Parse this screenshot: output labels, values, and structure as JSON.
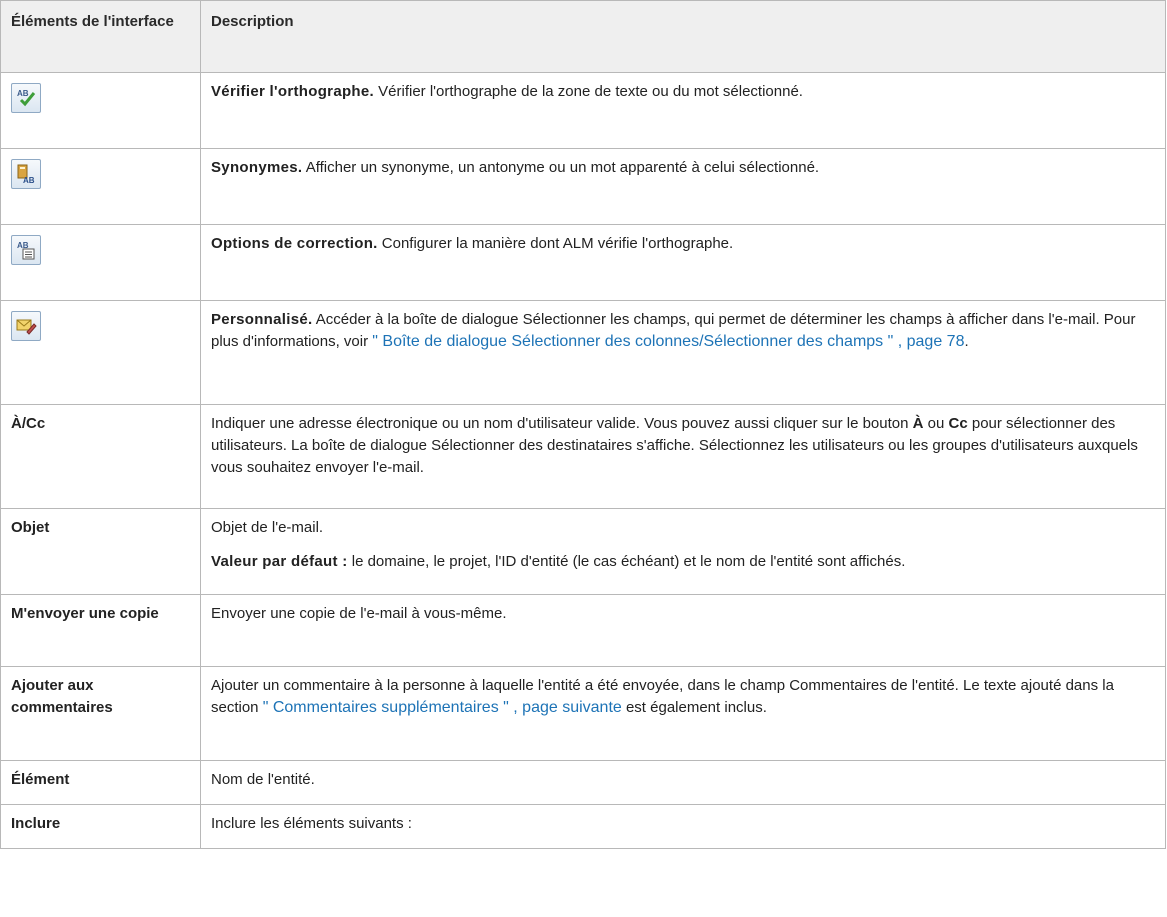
{
  "header": {
    "col1": "Éléments de l'interface",
    "col2": "Description"
  },
  "rows": [
    {
      "icon": "spell-check-icon",
      "lead": "Vérifier l'orthographe.",
      "text": " Vérifier l'orthographe de la zone de texte ou du mot sélectionné."
    },
    {
      "icon": "thesaurus-icon",
      "lead": "Synonymes.",
      "text": " Afficher un synonyme, un antonyme ou un mot apparenté à celui sélectionné."
    },
    {
      "icon": "spelling-options-icon",
      "lead": "Options de correction.",
      "text": " Configurer la manière dont ALM vérifie l'orthographe."
    },
    {
      "icon": "customize-email-icon",
      "lead": "Personnalisé.",
      "text": " Accéder à la boîte de dialogue Sélectionner les champs, qui permet de déterminer les champs à afficher dans l'e-mail. Pour plus d'informations, voir ",
      "link": "\" Boîte de dialogue Sélectionner des colonnes/Sélectionner des champs \" , page 78",
      "after": "."
    },
    {
      "label": "À/Cc",
      "t1": "Indiquer une adresse électronique ou un nom d'utilisateur valide. Vous pouvez aussi cliquer sur le bouton ",
      "b1": "À",
      "t2": " ou ",
      "b2": "Cc",
      "t3": " pour sélectionner des utilisateurs. La boîte de dialogue Sélectionner des destinataires s'affiche. Sélectionnez les utilisateurs ou les groupes d'utilisateurs auxquels vous souhaitez envoyer l'e-mail."
    },
    {
      "label": "Objet",
      "p1": "Objet de l'e-mail.",
      "lead": "Valeur par défaut :",
      "p2": " le domaine, le projet, l'ID d'entité (le cas échéant) et le nom de l'entité sont affichés."
    },
    {
      "label": "M'envoyer une copie",
      "text": "Envoyer une copie de l'e-mail à vous-même."
    },
    {
      "label": "Ajouter aux commentaires",
      "text": "Ajouter un commentaire à la personne à laquelle l'entité a été envoyée, dans le champ Commentaires de l'entité. Le texte ajouté dans la section ",
      "link": "\" Commentaires supplémentaires \" , page suivante",
      "after": " est également inclus."
    },
    {
      "label": "Élément",
      "text": "Nom de l'entité."
    },
    {
      "label": "Inclure",
      "text": "Inclure les éléments suivants :"
    }
  ]
}
